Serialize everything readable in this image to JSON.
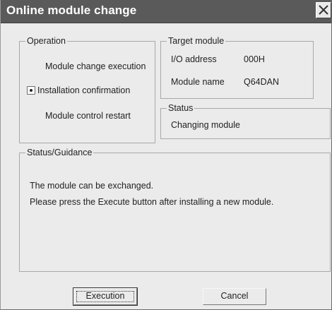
{
  "window": {
    "title": "Online module change"
  },
  "operation": {
    "legend": "Operation",
    "items": [
      {
        "label": "Module change execution",
        "selected": false
      },
      {
        "label": "Installation confirmation",
        "selected": true
      },
      {
        "label": "Module control restart",
        "selected": false
      }
    ]
  },
  "target_module": {
    "legend": "Target module",
    "io_label": "I/O address",
    "io_value": "000H",
    "name_label": "Module name",
    "name_value": "Q64DAN"
  },
  "status": {
    "legend": "Status",
    "text": "Changing module"
  },
  "guidance": {
    "legend": "Status/Guidance",
    "line1": "The module can be exchanged.",
    "line2": "Please press the Execute button after installing a new module."
  },
  "buttons": {
    "execution": "Execution",
    "cancel": "Cancel"
  },
  "icons": {
    "close": "close-icon",
    "radio": "radio-selected-icon"
  }
}
